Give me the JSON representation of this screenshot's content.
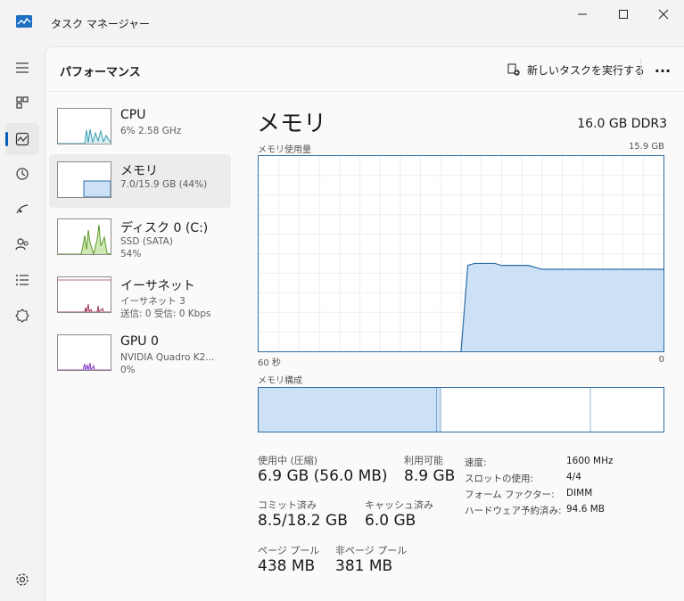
{
  "window": {
    "title": "タスク マネージャー",
    "controls": [
      "minimize",
      "maximize",
      "close"
    ]
  },
  "nav": {
    "items": [
      {
        "name": "hamburger-icon"
      },
      {
        "name": "processes-icon"
      },
      {
        "name": "performance-icon",
        "active": true
      },
      {
        "name": "app-history-icon"
      },
      {
        "name": "startup-apps-icon"
      },
      {
        "name": "users-icon"
      },
      {
        "name": "details-icon"
      },
      {
        "name": "services-icon"
      }
    ],
    "settings": "settings-icon"
  },
  "header": {
    "title": "パフォーマンス",
    "run_task": "新しいタスクを実行する",
    "more": "..."
  },
  "sidebar": {
    "items": [
      {
        "name": "CPU",
        "sub1": "6%  2.58 GHz"
      },
      {
        "name": "メモリ",
        "sub1": "7.0/15.9 GB (44%)",
        "selected": true
      },
      {
        "name": "ディスク 0 (C:)",
        "sub1": "SSD (SATA)",
        "sub2": "54%"
      },
      {
        "name": "イーサネット",
        "sub1": "イーサネット 3",
        "sub2": "送信: 0 受信: 0 Kbps"
      },
      {
        "name": "GPU 0",
        "sub1": "NVIDIA Quadro K2...",
        "sub2": "0%"
      }
    ]
  },
  "detail": {
    "title": "メモリ",
    "capacity": "16.0 GB DDR3",
    "usage_label": "メモリ使用量",
    "usage_max": "15.9 GB",
    "axis_left": "60 秒",
    "axis_right": "0",
    "composition_label": "メモリ構成",
    "composition": {
      "in_use_fraction": 0.44,
      "modified_fraction": 0.01,
      "standby_fraction": 0.37,
      "free_fraction": 0.18
    },
    "usage_history": [
      0,
      0,
      0,
      0,
      0,
      0,
      0,
      0,
      0,
      0,
      0,
      0,
      0,
      0,
      0,
      0,
      0,
      0,
      0,
      0,
      0,
      0,
      0,
      0,
      0,
      0,
      0,
      0,
      0,
      0,
      0,
      0.44,
      0.45,
      0.45,
      0.45,
      0.45,
      0.44,
      0.44,
      0.44,
      0.44,
      0.44,
      0.43,
      0.42,
      0.42,
      0.42,
      0.42,
      0.42,
      0.42,
      0.42,
      0.42,
      0.42,
      0.42,
      0.42,
      0.42,
      0.42,
      0.42,
      0.42,
      0.42,
      0.42,
      0.42,
      0.42
    ],
    "stats": {
      "in_use_label": "使用中 (圧縮)",
      "in_use": "6.9 GB (56.0 MB)",
      "available_label": "利用可能",
      "available": "8.9 GB",
      "committed_label": "コミット済み",
      "committed": "8.5/18.2 GB",
      "cached_label": "キャッシュ済み",
      "cached": "6.0 GB",
      "paged_label": "ページ プール",
      "paged": "438 MB",
      "nonpaged_label": "非ページ プール",
      "nonpaged": "381 MB"
    },
    "props": [
      {
        "key": "速度:",
        "value": "1600 MHz"
      },
      {
        "key": "スロットの使用:",
        "value": "4/4"
      },
      {
        "key": "フォーム ファクター:",
        "value": "DIMM"
      },
      {
        "key": "ハードウェア予約済み:",
        "value": "94.6 MB"
      }
    ]
  },
  "colors": {
    "accent": "#005fb8",
    "memory_line": "#2e6ea6",
    "memory_fill": "#cce0f6",
    "cpu_line": "#3a9fb0",
    "disk_line": "#5e9a2a",
    "disk_fill": "#cfe8b4",
    "net_line": "#a0385e",
    "gpu_line": "#8a3fc7"
  }
}
